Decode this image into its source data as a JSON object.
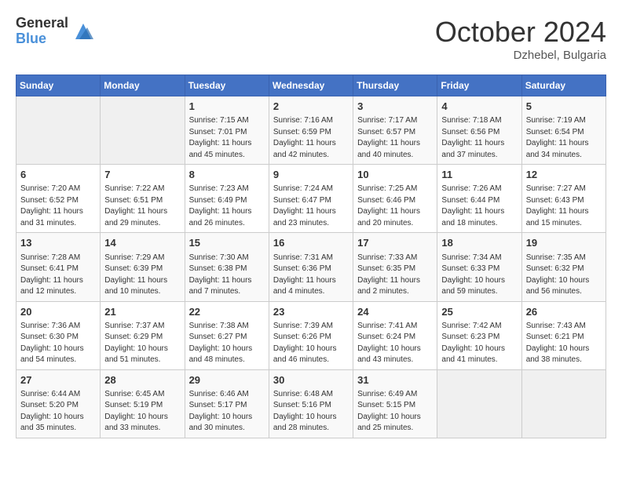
{
  "header": {
    "logo_general": "General",
    "logo_blue": "Blue",
    "month_title": "October 2024",
    "location": "Dzhebel, Bulgaria"
  },
  "weekdays": [
    "Sunday",
    "Monday",
    "Tuesday",
    "Wednesday",
    "Thursday",
    "Friday",
    "Saturday"
  ],
  "weeks": [
    [
      {
        "day": "",
        "empty": true
      },
      {
        "day": "",
        "empty": true
      },
      {
        "day": "1",
        "sunrise": "Sunrise: 7:15 AM",
        "sunset": "Sunset: 7:01 PM",
        "daylight": "Daylight: 11 hours and 45 minutes."
      },
      {
        "day": "2",
        "sunrise": "Sunrise: 7:16 AM",
        "sunset": "Sunset: 6:59 PM",
        "daylight": "Daylight: 11 hours and 42 minutes."
      },
      {
        "day": "3",
        "sunrise": "Sunrise: 7:17 AM",
        "sunset": "Sunset: 6:57 PM",
        "daylight": "Daylight: 11 hours and 40 minutes."
      },
      {
        "day": "4",
        "sunrise": "Sunrise: 7:18 AM",
        "sunset": "Sunset: 6:56 PM",
        "daylight": "Daylight: 11 hours and 37 minutes."
      },
      {
        "day": "5",
        "sunrise": "Sunrise: 7:19 AM",
        "sunset": "Sunset: 6:54 PM",
        "daylight": "Daylight: 11 hours and 34 minutes."
      }
    ],
    [
      {
        "day": "6",
        "sunrise": "Sunrise: 7:20 AM",
        "sunset": "Sunset: 6:52 PM",
        "daylight": "Daylight: 11 hours and 31 minutes."
      },
      {
        "day": "7",
        "sunrise": "Sunrise: 7:22 AM",
        "sunset": "Sunset: 6:51 PM",
        "daylight": "Daylight: 11 hours and 29 minutes."
      },
      {
        "day": "8",
        "sunrise": "Sunrise: 7:23 AM",
        "sunset": "Sunset: 6:49 PM",
        "daylight": "Daylight: 11 hours and 26 minutes."
      },
      {
        "day": "9",
        "sunrise": "Sunrise: 7:24 AM",
        "sunset": "Sunset: 6:47 PM",
        "daylight": "Daylight: 11 hours and 23 minutes."
      },
      {
        "day": "10",
        "sunrise": "Sunrise: 7:25 AM",
        "sunset": "Sunset: 6:46 PM",
        "daylight": "Daylight: 11 hours and 20 minutes."
      },
      {
        "day": "11",
        "sunrise": "Sunrise: 7:26 AM",
        "sunset": "Sunset: 6:44 PM",
        "daylight": "Daylight: 11 hours and 18 minutes."
      },
      {
        "day": "12",
        "sunrise": "Sunrise: 7:27 AM",
        "sunset": "Sunset: 6:43 PM",
        "daylight": "Daylight: 11 hours and 15 minutes."
      }
    ],
    [
      {
        "day": "13",
        "sunrise": "Sunrise: 7:28 AM",
        "sunset": "Sunset: 6:41 PM",
        "daylight": "Daylight: 11 hours and 12 minutes."
      },
      {
        "day": "14",
        "sunrise": "Sunrise: 7:29 AM",
        "sunset": "Sunset: 6:39 PM",
        "daylight": "Daylight: 11 hours and 10 minutes."
      },
      {
        "day": "15",
        "sunrise": "Sunrise: 7:30 AM",
        "sunset": "Sunset: 6:38 PM",
        "daylight": "Daylight: 11 hours and 7 minutes."
      },
      {
        "day": "16",
        "sunrise": "Sunrise: 7:31 AM",
        "sunset": "Sunset: 6:36 PM",
        "daylight": "Daylight: 11 hours and 4 minutes."
      },
      {
        "day": "17",
        "sunrise": "Sunrise: 7:33 AM",
        "sunset": "Sunset: 6:35 PM",
        "daylight": "Daylight: 11 hours and 2 minutes."
      },
      {
        "day": "18",
        "sunrise": "Sunrise: 7:34 AM",
        "sunset": "Sunset: 6:33 PM",
        "daylight": "Daylight: 10 hours and 59 minutes."
      },
      {
        "day": "19",
        "sunrise": "Sunrise: 7:35 AM",
        "sunset": "Sunset: 6:32 PM",
        "daylight": "Daylight: 10 hours and 56 minutes."
      }
    ],
    [
      {
        "day": "20",
        "sunrise": "Sunrise: 7:36 AM",
        "sunset": "Sunset: 6:30 PM",
        "daylight": "Daylight: 10 hours and 54 minutes."
      },
      {
        "day": "21",
        "sunrise": "Sunrise: 7:37 AM",
        "sunset": "Sunset: 6:29 PM",
        "daylight": "Daylight: 10 hours and 51 minutes."
      },
      {
        "day": "22",
        "sunrise": "Sunrise: 7:38 AM",
        "sunset": "Sunset: 6:27 PM",
        "daylight": "Daylight: 10 hours and 48 minutes."
      },
      {
        "day": "23",
        "sunrise": "Sunrise: 7:39 AM",
        "sunset": "Sunset: 6:26 PM",
        "daylight": "Daylight: 10 hours and 46 minutes."
      },
      {
        "day": "24",
        "sunrise": "Sunrise: 7:41 AM",
        "sunset": "Sunset: 6:24 PM",
        "daylight": "Daylight: 10 hours and 43 minutes."
      },
      {
        "day": "25",
        "sunrise": "Sunrise: 7:42 AM",
        "sunset": "Sunset: 6:23 PM",
        "daylight": "Daylight: 10 hours and 41 minutes."
      },
      {
        "day": "26",
        "sunrise": "Sunrise: 7:43 AM",
        "sunset": "Sunset: 6:21 PM",
        "daylight": "Daylight: 10 hours and 38 minutes."
      }
    ],
    [
      {
        "day": "27",
        "sunrise": "Sunrise: 6:44 AM",
        "sunset": "Sunset: 5:20 PM",
        "daylight": "Daylight: 10 hours and 35 minutes."
      },
      {
        "day": "28",
        "sunrise": "Sunrise: 6:45 AM",
        "sunset": "Sunset: 5:19 PM",
        "daylight": "Daylight: 10 hours and 33 minutes."
      },
      {
        "day": "29",
        "sunrise": "Sunrise: 6:46 AM",
        "sunset": "Sunset: 5:17 PM",
        "daylight": "Daylight: 10 hours and 30 minutes."
      },
      {
        "day": "30",
        "sunrise": "Sunrise: 6:48 AM",
        "sunset": "Sunset: 5:16 PM",
        "daylight": "Daylight: 10 hours and 28 minutes."
      },
      {
        "day": "31",
        "sunrise": "Sunrise: 6:49 AM",
        "sunset": "Sunset: 5:15 PM",
        "daylight": "Daylight: 10 hours and 25 minutes."
      },
      {
        "day": "",
        "empty": true
      },
      {
        "day": "",
        "empty": true
      }
    ]
  ]
}
